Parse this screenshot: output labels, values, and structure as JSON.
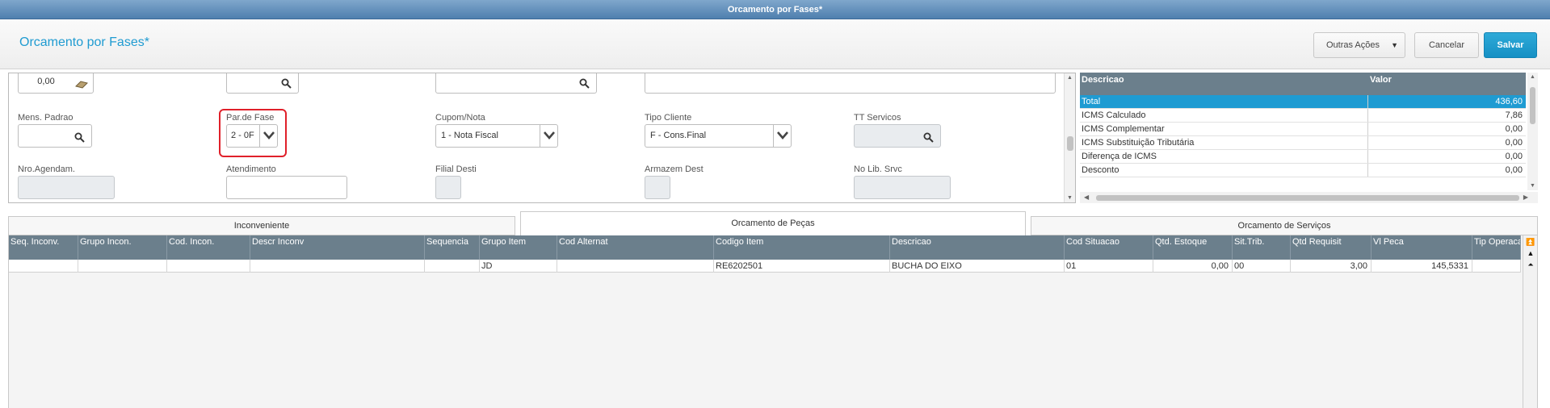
{
  "window": {
    "title": "Orcamento por Fases*"
  },
  "header": {
    "title": "Orcamento por Fases*",
    "buttons": {
      "outras_acoes": "Outras Ações",
      "cancelar": "Cancelar",
      "salvar": "Salvar"
    }
  },
  "form": {
    "row0": {
      "valor": "0,00"
    },
    "mens_padrao": {
      "label": "Mens. Padrao",
      "value": ""
    },
    "par_fase": {
      "label": "Par.de Fase",
      "value": "2 - 0F"
    },
    "cupom_nota": {
      "label": "Cupom/Nota",
      "value": "1 - Nota Fiscal"
    },
    "tipo_cliente": {
      "label": "Tipo Cliente",
      "value": "F - Cons.Final"
    },
    "tt_servicos": {
      "label": "TT Servicos",
      "value": ""
    },
    "nro_agendam": {
      "label": "Nro.Agendam.",
      "value": ""
    },
    "atendimento": {
      "label": "Atendimento",
      "value": ""
    },
    "filial_desti": {
      "label": "Filial Desti",
      "value": ""
    },
    "armazem_dest": {
      "label": "Armazem Dest",
      "value": ""
    },
    "no_lib_srvc": {
      "label": "No Lib. Srvc",
      "value": ""
    }
  },
  "summary": {
    "headers": {
      "descricao": "Descricao",
      "valor": "Valor"
    },
    "rows": [
      {
        "descricao": "Total",
        "valor": "436,60"
      },
      {
        "descricao": "ICMS Calculado",
        "valor": "7,86"
      },
      {
        "descricao": "ICMS Complementar",
        "valor": "0,00"
      },
      {
        "descricao": "ICMS Substituição Tributária",
        "valor": "0,00"
      },
      {
        "descricao": "Diferença de ICMS",
        "valor": "0,00"
      },
      {
        "descricao": "Desconto",
        "valor": "0,00"
      }
    ]
  },
  "tabs": [
    {
      "label": "Inconveniente"
    },
    {
      "label": "Orcamento de Peças"
    },
    {
      "label": "Orcamento de Serviços"
    }
  ],
  "grid": {
    "headers": [
      "Seq. Inconv.",
      "Grupo Incon.",
      "Cod. Incon.",
      "Descr Inconv",
      "Sequencia",
      "Grupo Item",
      "Cod Alternat",
      "Codigo Item",
      "Descricao",
      "Cod Situacao",
      "Qtd. Estoque",
      "Sit.Trib.",
      "Qtd Requisit",
      "Vl Peca",
      "Tip Operacao"
    ],
    "rows": [
      [
        "",
        "",
        "",
        "",
        "",
        "JD",
        "",
        "RE6202501",
        "BUCHA DO EIXO",
        "01",
        "0,00",
        "00",
        "3,00",
        "145,5331",
        ""
      ]
    ]
  },
  "colors": {
    "accent": "#1e9bd2",
    "header_bg": "#6b7f8c",
    "highlight": "#e0202a"
  }
}
